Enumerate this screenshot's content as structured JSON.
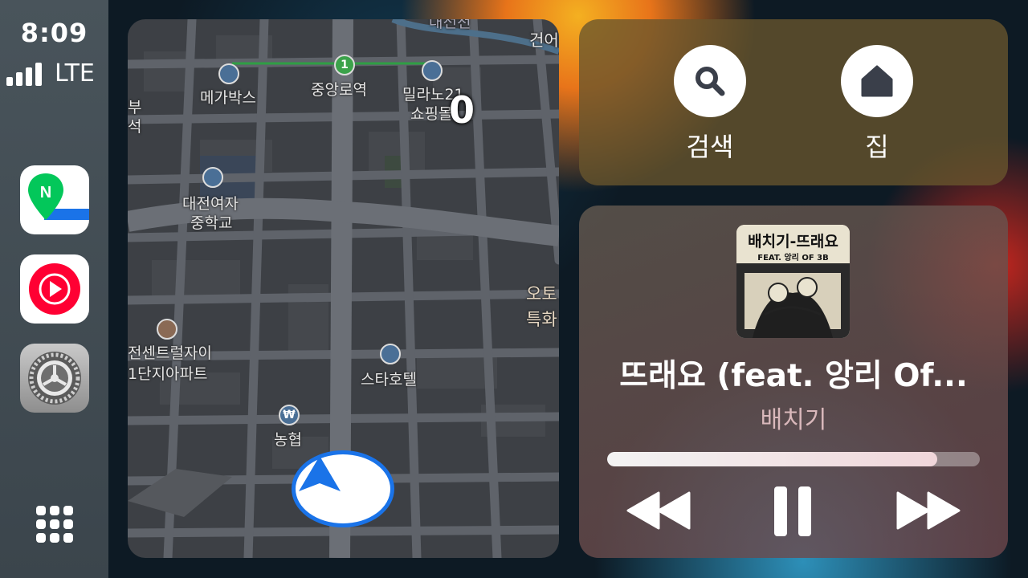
{
  "status": {
    "time": "8:09",
    "network": "LTE"
  },
  "sidebar": {
    "apps": [
      {
        "name": "Naver Map",
        "icon": "naver-map-icon"
      },
      {
        "name": "YouTube Music",
        "icon": "youtube-music-icon"
      },
      {
        "name": "Settings",
        "icon": "settings-gear-icon"
      }
    ],
    "grid_icon": "app-grid-icon"
  },
  "map": {
    "labels": {
      "top_cut": "대전천",
      "station": "중앙로역",
      "station_number": "1",
      "megabox": "메가박스",
      "milano_1": "밀라노21",
      "milano_2": "쇼핑몰",
      "left_cut_1": "부",
      "left_cut_2": "석",
      "school_1": "대전여자",
      "school_2": "중학교",
      "right_cut_top": "건어",
      "right_cut_1": "오토",
      "right_cut_2": "특화",
      "apt_1": "전센트럴자이",
      "apt_2": "1단지아파트",
      "hotel": "스타호텔",
      "bank": "농협",
      "bank_symbol": "₩"
    },
    "overlay_number": "0",
    "nav_icon": "navigation-arrow-icon"
  },
  "shortcuts": {
    "search_label": "검색",
    "home_label": "집"
  },
  "now_playing": {
    "art_title": "배치기-뜨래요",
    "art_subtitle": "FEAT. 앙리 OF 3B",
    "title": "뜨래요 (feat. 앙리 Of...",
    "artist": "배치기",
    "progress": 0.885
  },
  "colors": {
    "accent_blue": "#1a73e8",
    "youtube_red": "#ff0033",
    "naver_green": "#03c75a"
  }
}
